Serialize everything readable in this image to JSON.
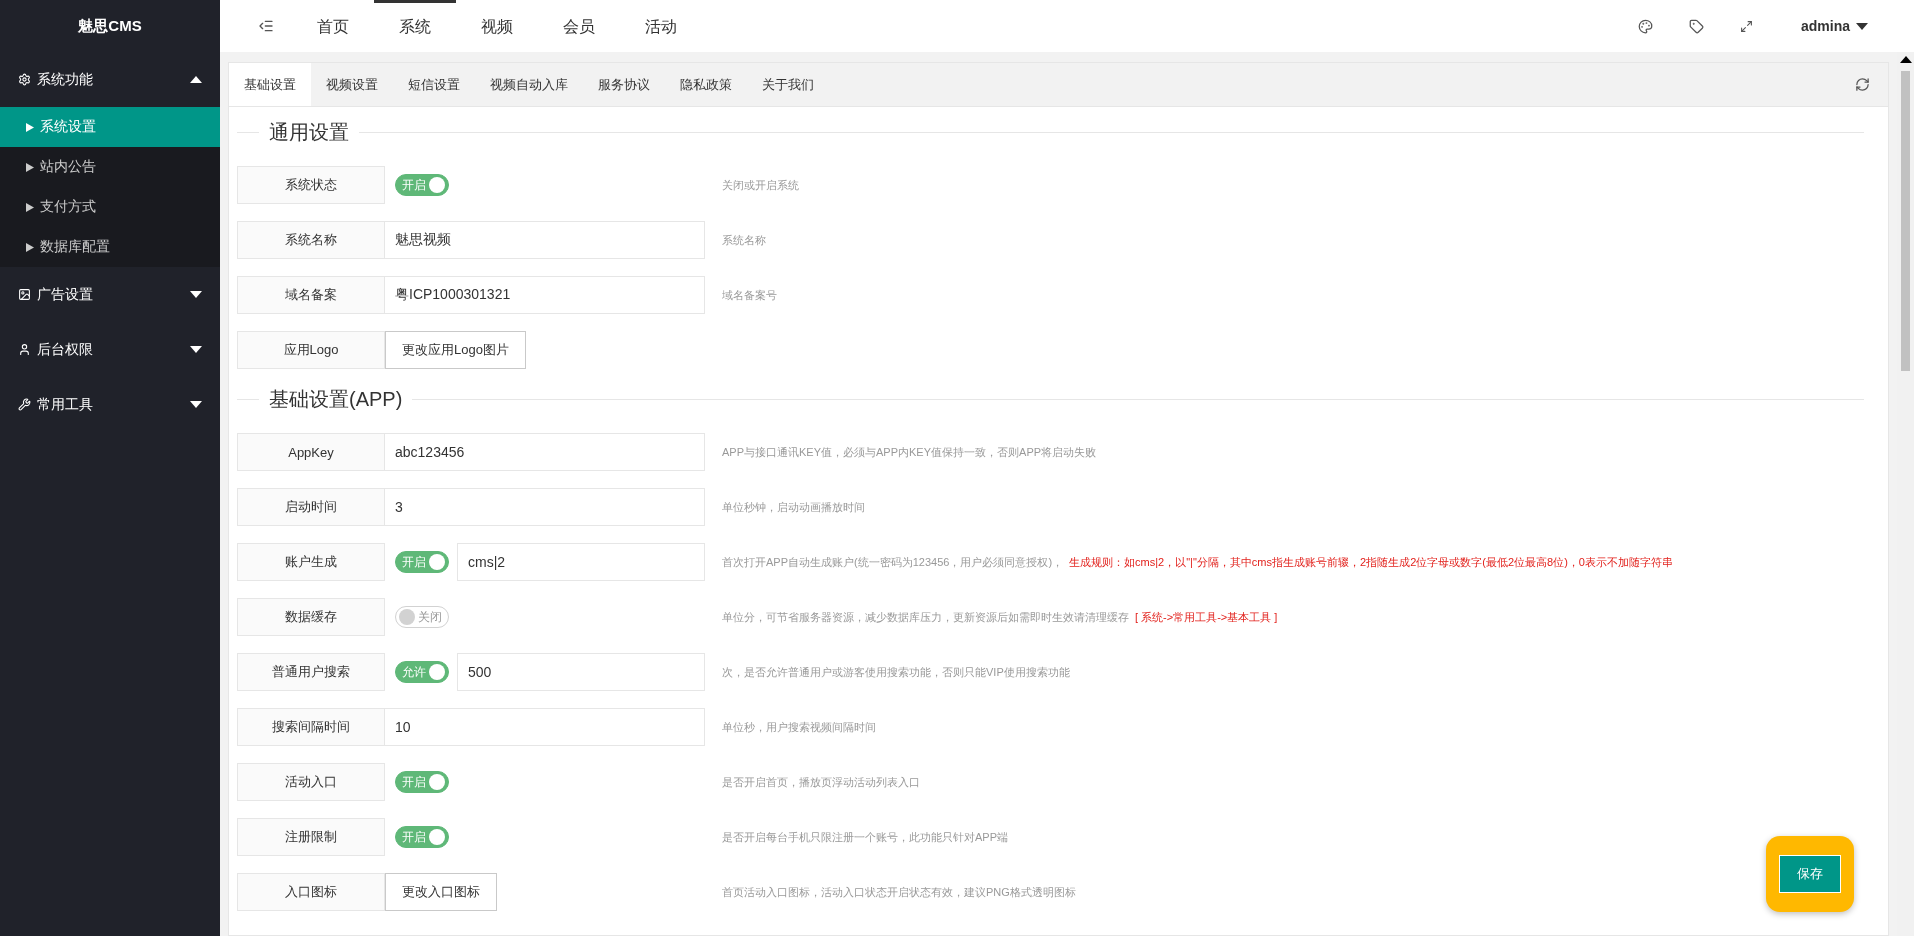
{
  "sidebar": {
    "title": "魅思CMS",
    "groups": [
      {
        "label": "系统功能",
        "kind": "gear",
        "expanded": true,
        "items": [
          {
            "label": "系统设置",
            "selected": true
          },
          {
            "label": "站内公告",
            "selected": false
          },
          {
            "label": "支付方式",
            "selected": false
          },
          {
            "label": "数据库配置",
            "selected": false
          }
        ]
      },
      {
        "label": "广告设置",
        "kind": "image",
        "expanded": false
      },
      {
        "label": "后台权限",
        "kind": "user",
        "expanded": false
      },
      {
        "label": "常用工具",
        "kind": "wrench",
        "expanded": false
      }
    ]
  },
  "topnav": {
    "items": [
      {
        "label": "首页",
        "selected": false
      },
      {
        "label": "系统",
        "selected": true
      },
      {
        "label": "视频",
        "selected": false
      },
      {
        "label": "会员",
        "selected": false
      },
      {
        "label": "活动",
        "selected": false
      }
    ],
    "user": "admina"
  },
  "tabs": [
    {
      "label": "基础设置",
      "selected": true
    },
    {
      "label": "视频设置",
      "selected": false
    },
    {
      "label": "短信设置",
      "selected": false
    },
    {
      "label": "视频自动入库",
      "selected": false
    },
    {
      "label": "服务协议",
      "selected": false
    },
    {
      "label": "隐私政策",
      "selected": false
    },
    {
      "label": "关于我们",
      "selected": false
    }
  ],
  "sections": [
    {
      "title": "通用设置",
      "rows": [
        {
          "label": "系统状态",
          "kind": "toggle",
          "toggle": {
            "on": true,
            "text": "开启"
          },
          "help": "关闭或开启系统"
        },
        {
          "label": "系统名称",
          "kind": "input",
          "value": "魅思视频",
          "help": "系统名称"
        },
        {
          "label": "域名备案",
          "kind": "input",
          "value": "粤ICP1000301321",
          "help": "域名备案号"
        },
        {
          "label": "应用Logo",
          "kind": "upload",
          "button": "更改应用Logo图片"
        }
      ]
    },
    {
      "title": "基础设置(APP)",
      "rows": [
        {
          "label": "AppKey",
          "kind": "input",
          "value": "abc123456",
          "help": "APP与接口通讯KEY值，必须与APP内KEY值保持一致，否则APP将启动失败"
        },
        {
          "label": "启动时间",
          "kind": "input",
          "value": "3",
          "help": "单位秒钟，启动动画播放时间"
        },
        {
          "label": "账户生成",
          "kind": "toggle-input",
          "toggle": {
            "on": true,
            "text": "开启"
          },
          "value": "cms|2",
          "help": "首次打开APP自动生成账户(统一密码为123456，用户必须同意授权)，",
          "note": "生成规则：如cms|2，以\"|\"分隔，其中cms指生成账号前辍，2指随生成2位字母或数字(最低2位最高8位)，0表示不加随字符串"
        },
        {
          "label": "数据缓存",
          "kind": "toggle",
          "toggle": {
            "on": false,
            "text": "关闭"
          },
          "help": "单位分，可节省服务器资源，减少数据库压力，更新资源后如需即时生效请清理缓存",
          "note": "[ 系统->常用工具->基本工具 ]"
        },
        {
          "label": "普通用户搜索",
          "kind": "toggle-input",
          "toggle": {
            "on": true,
            "text": "允许"
          },
          "value": "500",
          "help": "次，是否允许普通用户或游客使用搜索功能，否则只能VIP使用搜索功能"
        },
        {
          "label": "搜索间隔时间",
          "kind": "input",
          "value": "10",
          "help": "单位秒，用户搜索视频间隔时间"
        },
        {
          "label": "活动入口",
          "kind": "toggle",
          "toggle": {
            "on": true,
            "text": "开启"
          },
          "help": "是否开启首页，播放页浮动活动列表入口"
        },
        {
          "label": "注册限制",
          "kind": "toggle",
          "toggle": {
            "on": true,
            "text": "开启"
          },
          "help": "是否开启每台手机只限注册一个账号，此功能只针对APP端"
        },
        {
          "label": "入口图标",
          "kind": "upload",
          "button": "更改入口图标",
          "help": "首页活动入口图标，活动入口状态开启状态有效，建议PNG格式透明图标"
        }
      ]
    }
  ],
  "save_button": "保存"
}
